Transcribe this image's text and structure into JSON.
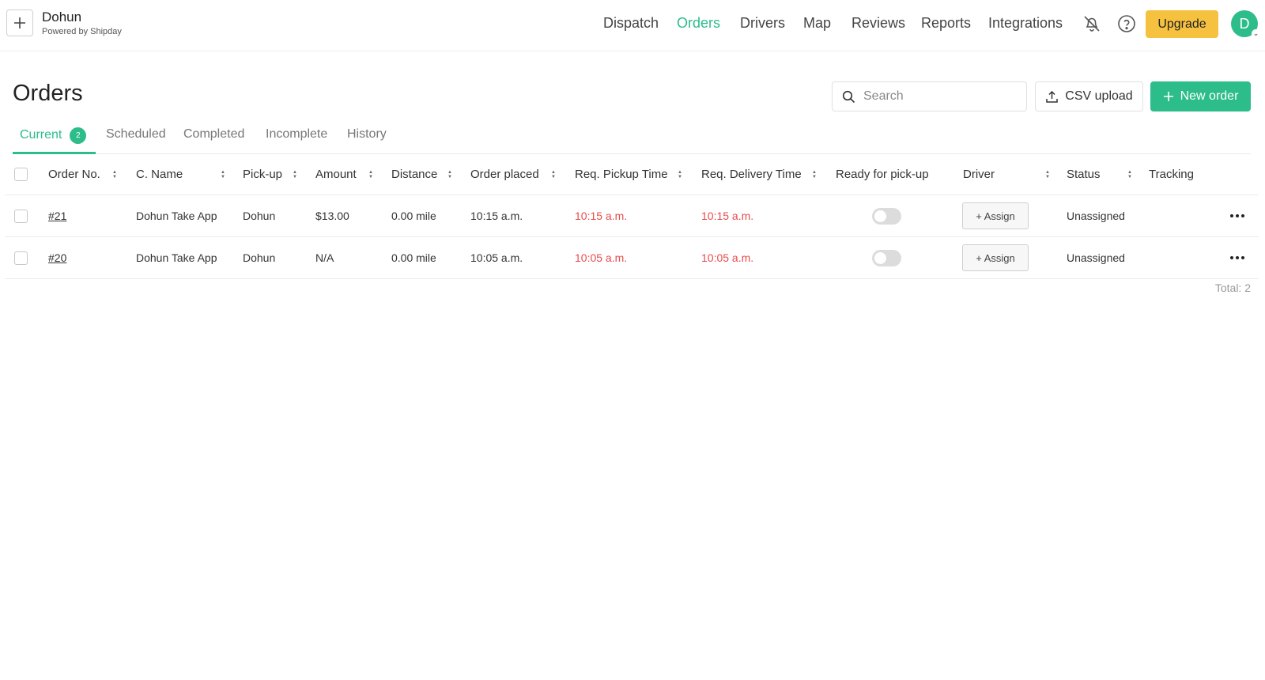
{
  "brand": {
    "name": "Dohun",
    "subtitle": "Powered by Shipday"
  },
  "nav": [
    {
      "label": "Dispatch",
      "active": false
    },
    {
      "label": "Orders",
      "active": true
    },
    {
      "label": "Drivers",
      "active": false
    },
    {
      "label": "Map",
      "active": false
    },
    {
      "label": "Reviews",
      "active": false
    },
    {
      "label": "Reports",
      "active": false
    },
    {
      "label": "Integrations",
      "active": false
    }
  ],
  "topbar": {
    "upgrade_label": "Upgrade",
    "avatar_initial": "D",
    "icons": [
      "bell-off-icon",
      "help-icon"
    ]
  },
  "page": {
    "title": "Orders",
    "search_placeholder": "Search",
    "csv_label": "CSV upload",
    "new_order_label": "New order"
  },
  "tabs": [
    {
      "label": "Current",
      "badge": "2",
      "active": true
    },
    {
      "label": "Scheduled"
    },
    {
      "label": "Completed"
    },
    {
      "label": "Incomplete"
    },
    {
      "label": "History"
    }
  ],
  "table": {
    "headers": {
      "order_no": "Order No.",
      "c_name": "C. Name",
      "pickup": "Pick-up",
      "amount": "Amount",
      "distance": "Distance",
      "order_placed": "Order placed",
      "req_pickup": "Req. Pickup Time",
      "req_delivery": "Req. Delivery Time",
      "ready": "Ready for pick-up",
      "driver": "Driver",
      "status": "Status",
      "tracking": "Tracking"
    },
    "rows": [
      {
        "order_no": "#21",
        "c_name": "Dohun Take App",
        "pickup": "Dohun",
        "amount": "$13.00",
        "distance": "0.00 mile",
        "order_placed": "10:15 a.m.",
        "req_pickup": "10:15 a.m.",
        "req_delivery": "10:15 a.m.",
        "ready": false,
        "assign_label": "+ Assign",
        "status": "Unassigned"
      },
      {
        "order_no": "#20",
        "c_name": "Dohun Take App",
        "pickup": "Dohun",
        "amount": "N/A",
        "distance": "0.00 mile",
        "order_placed": "10:05 a.m.",
        "req_pickup": "10:05 a.m.",
        "req_delivery": "10:05 a.m.",
        "ready": false,
        "assign_label": "+ Assign",
        "status": "Unassigned"
      }
    ],
    "total": "Total: 2"
  },
  "colors": {
    "accent": "#2dbd8a",
    "upgrade": "#f7c140",
    "overdue": "#e84b4b"
  }
}
